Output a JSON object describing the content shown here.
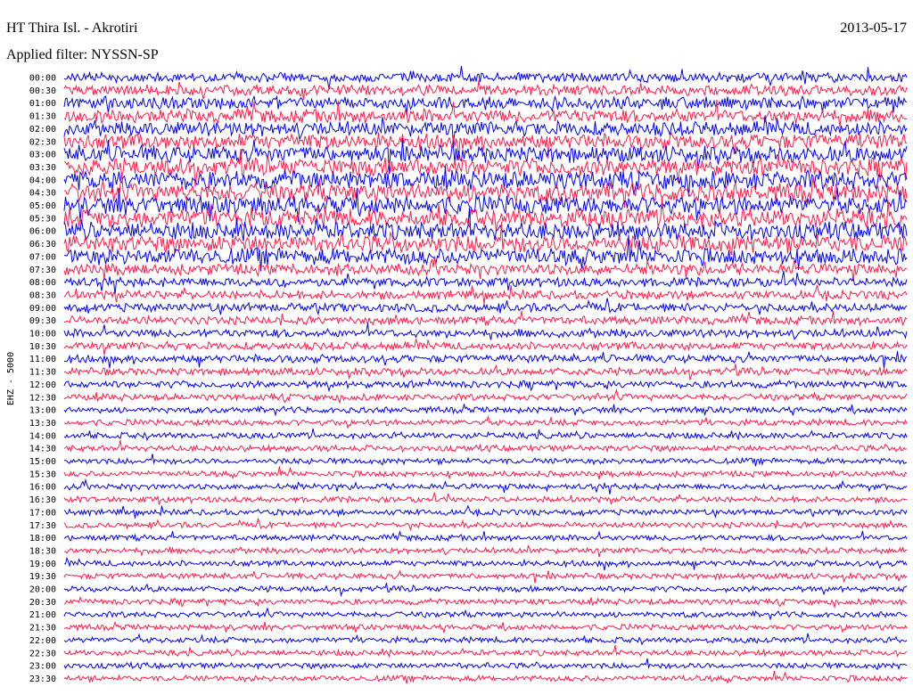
{
  "header": {
    "station": "HT Thira Isl. - Akrotiri",
    "date": "2013-05-17",
    "filter_label": "Applied filter: NYSSN-SP"
  },
  "chart_data": {
    "type": "line",
    "title": "HT Thira Isl. - Akrotiri",
    "date": "2013-05-17",
    "filter": "Applied filter: NYSSN-SP",
    "ylabel": "EHZ - 5000",
    "xlabel": "",
    "tick_labels": [
      "00:00",
      "00:30",
      "01:00",
      "01:30",
      "02:00",
      "02:30",
      "03:00",
      "03:30",
      "04:00",
      "04:30",
      "05:00",
      "05:30",
      "06:00",
      "06:30",
      "07:00",
      "07:30",
      "08:00",
      "08:30",
      "09:00",
      "09:30",
      "10:00",
      "10:30",
      "11:00",
      "11:30",
      "12:00",
      "12:30",
      "13:00",
      "13:30",
      "14:00",
      "14:30",
      "15:00",
      "15:30",
      "16:00",
      "16:30",
      "17:00",
      "17:30",
      "18:00",
      "18:30",
      "19:00",
      "19:30",
      "20:00",
      "20:30",
      "21:00",
      "21:30",
      "22:00",
      "22:30",
      "23:00",
      "23:30"
    ],
    "colors": [
      "#0000ee",
      "#ff1a4a"
    ],
    "noise_level": [
      0.45,
      0.5,
      0.6,
      0.65,
      0.7,
      0.75,
      0.8,
      0.85,
      0.9,
      0.9,
      0.9,
      0.9,
      0.85,
      0.85,
      0.8,
      0.55,
      0.45,
      0.42,
      0.42,
      0.4,
      0.4,
      0.38,
      0.38,
      0.36,
      0.35,
      0.32,
      0.3,
      0.3,
      0.3,
      0.3,
      0.28,
      0.28,
      0.28,
      0.28,
      0.28,
      0.28,
      0.28,
      0.28,
      0.28,
      0.28,
      0.28,
      0.28,
      0.28,
      0.28,
      0.28,
      0.28,
      0.28,
      0.28
    ]
  },
  "colors": {
    "background": "#ffffff",
    "text": "#000000"
  }
}
